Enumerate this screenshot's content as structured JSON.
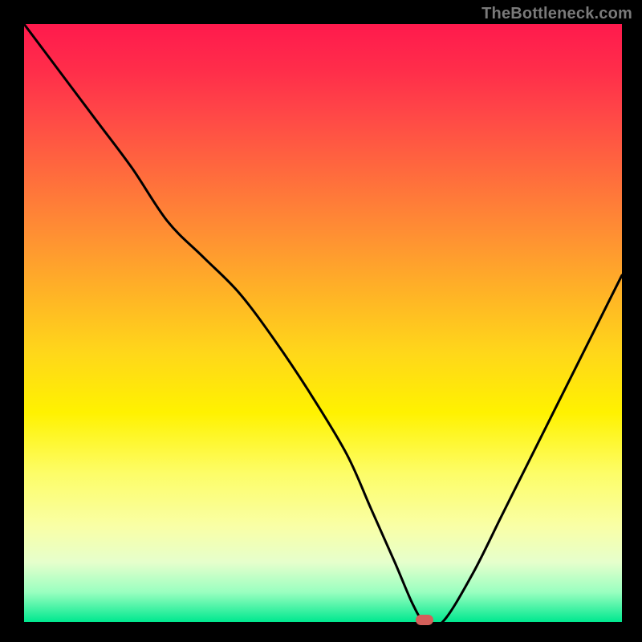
{
  "watermark": "TheBottleneck.com",
  "colors": {
    "gradient_top": "#ff1a4d",
    "gradient_mid": "#ffd71a",
    "gradient_bottom": "#00e88f",
    "curve_stroke": "#000000",
    "marker_fill": "#d45f5a",
    "background": "#000000"
  },
  "chart_data": {
    "type": "line",
    "title": "",
    "xlabel": "",
    "ylabel": "",
    "xlim": [
      0,
      100
    ],
    "ylim": [
      0,
      100
    ],
    "series": [
      {
        "name": "bottleneck-curve",
        "x": [
          0,
          6,
          12,
          18,
          24,
          30,
          36,
          42,
          48,
          54,
          58,
          62,
          65,
          67,
          70,
          75,
          80,
          85,
          90,
          95,
          100
        ],
        "y": [
          100,
          92,
          84,
          76,
          67,
          61,
          55,
          47,
          38,
          28,
          19,
          10,
          3,
          0,
          0,
          8,
          18,
          28,
          38,
          48,
          58
        ]
      }
    ],
    "annotations": [
      {
        "name": "optimal-marker",
        "x": 67,
        "y": 0
      }
    ]
  }
}
